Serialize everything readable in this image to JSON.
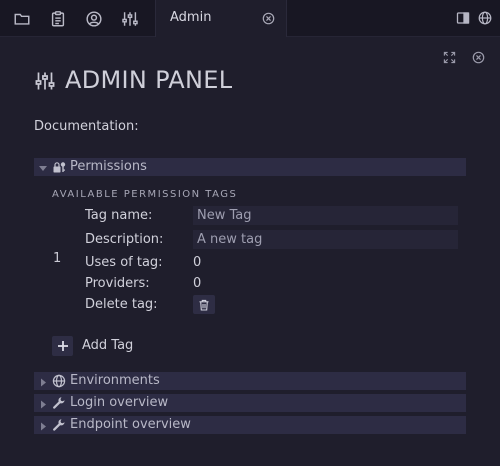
{
  "topbar": {
    "icons": [
      "folder-icon",
      "clipboard-icon",
      "user-circle-icon",
      "sliders-icon"
    ],
    "active_tab": {
      "label": "Admin",
      "close_icon": "close-circle-icon"
    },
    "right_icons": [
      "panel-toggle-icon",
      "globe-icon"
    ]
  },
  "window_controls": {
    "expand_icon": "expand-icon",
    "close_icon": "close-circle-icon"
  },
  "page": {
    "title": "ADMIN PANEL",
    "title_icon": "sliders-icon",
    "documentation_label": "Documentation:"
  },
  "permissions": {
    "header": "Permissions",
    "icon": "lock-key-icon",
    "expanded": true,
    "caption": "AVAILABLE PERMISSION TAGS",
    "tags": [
      {
        "index": "1",
        "name_label": "Tag name:",
        "name_value": "New Tag",
        "description_label": "Description:",
        "description_value": "A new tag",
        "uses_label": "Uses of tag:",
        "uses_value": "0",
        "providers_label": "Providers:",
        "providers_value": "0",
        "delete_label": "Delete tag:",
        "delete_icon": "trash-icon"
      }
    ],
    "add_tag_label": "Add Tag"
  },
  "sections": [
    {
      "label": "Environments",
      "icon": "globe-icon",
      "expanded": false
    },
    {
      "label": "Login overview",
      "icon": "wrench-icon",
      "expanded": false
    },
    {
      "label": "Endpoint overview",
      "icon": "wrench-icon",
      "expanded": false
    }
  ],
  "colors": {
    "background": "#1f1e2c",
    "topbar": "#181723",
    "section_header": "#2d2c44",
    "input_background": "#262537",
    "text": "#d1d1db",
    "placeholder_text": "#9e9eb0"
  }
}
